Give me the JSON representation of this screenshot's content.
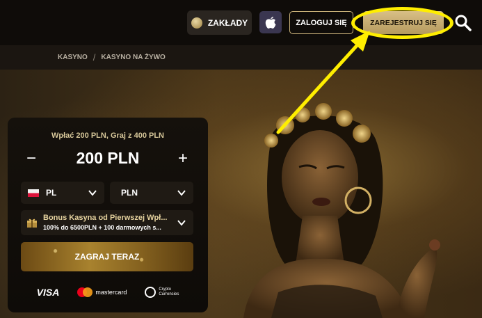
{
  "header": {
    "bets_label": "ZAKŁADY",
    "login_label": "ZALOGUJ SIĘ",
    "register_label": "ZAREJESTRUJ SIĘ",
    "icons": [
      "football-icon",
      "apple-icon",
      "search-icon"
    ]
  },
  "breadcrumb": {
    "items": [
      "KASYNO",
      "KASYNO NA ŻYWO"
    ],
    "separator": "/"
  },
  "deposit": {
    "title": "Wpłać 200 PLN, Graj z 400 PLN",
    "minus": "−",
    "amount": "200 PLN",
    "plus": "+",
    "country": "PL",
    "currency": "PLN",
    "bonus_name": "Bonus Kasyna od Pierwszej Wpł...",
    "bonus_desc": "100% do 6500PLN + 100 darmowych s...",
    "play_label": "ZAGRAJ TERAZ"
  },
  "payments": {
    "visa": "VISA",
    "mastercard": "mastercard",
    "crypto_line1": "Crypto",
    "crypto_line2": "Currencies"
  },
  "colors": {
    "annotation": "#ffee00",
    "accent_gold": "#cbb37a"
  }
}
